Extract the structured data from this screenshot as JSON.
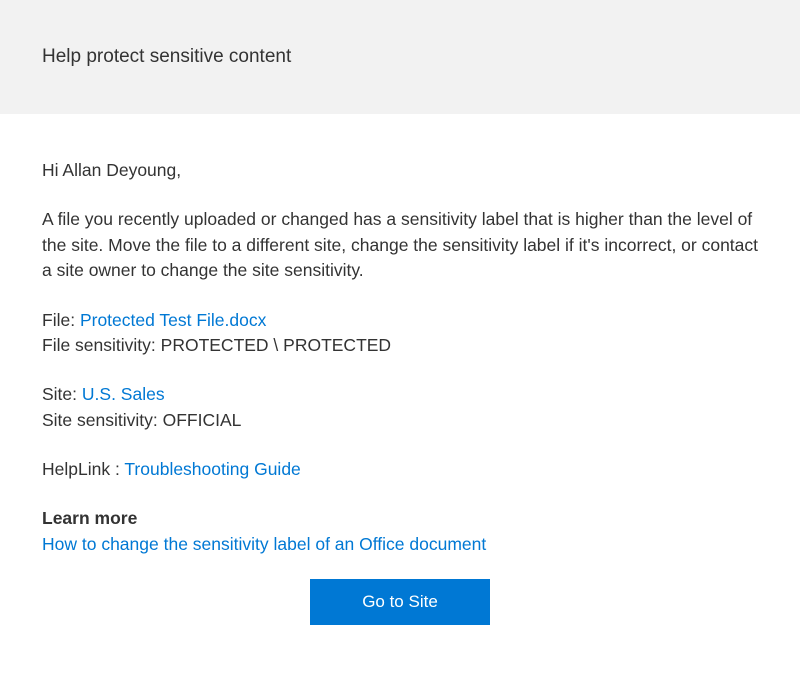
{
  "header": {
    "title": "Help protect sensitive content"
  },
  "body": {
    "greeting": "Hi Allan Deyoung,",
    "description": "A file you recently uploaded or changed has a sensitivity label that is higher than the level of the site. Move the file to a different site, change the sensitivity label if it's incorrect, or contact a site owner to change the site sensitivity.",
    "file_label": "File: ",
    "file_link": "Protected Test File.docx",
    "file_sensitivity_label": "File sensitivity: ",
    "file_sensitivity_value": "PROTECTED \\ PROTECTED",
    "site_label": "Site: ",
    "site_link": "U.S. Sales",
    "site_sensitivity_label": "Site sensitivity: ",
    "site_sensitivity_value": "OFFICIAL",
    "helplink_label": "HelpLink : ",
    "helplink_text": "Troubleshooting Guide",
    "learnmore_title": "Learn more",
    "learnmore_link": "How to change the sensitivity label of an Office document"
  },
  "button": {
    "go_to_site": "Go to Site"
  }
}
